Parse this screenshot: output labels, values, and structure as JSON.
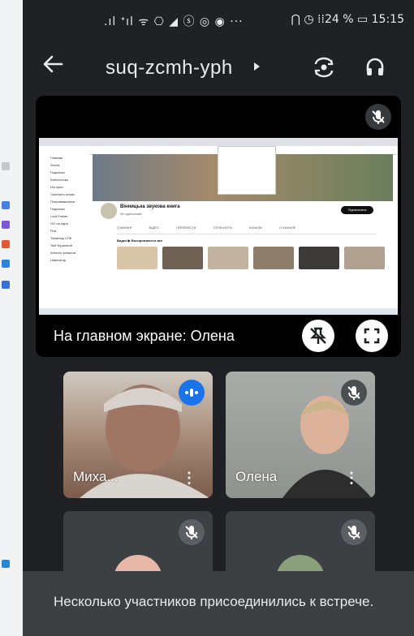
{
  "status_bar": {
    "left_icons": ".ıl ᐩıl ᯤ ⎔ ◢ ⓢ ◎ ◉ ···",
    "right_text": "⋂ ◷ ⁞⁞24 % ▭ 15:15"
  },
  "header": {
    "meeting_code": "suq-zcmh-yph"
  },
  "stage": {
    "label": "На главном экране: Олена",
    "shared_screen": {
      "channel_name": "Вінницька звукова книга",
      "channel_sub": "96 підписників",
      "subscribe_label": "Підписатися",
      "tabs": [
        "ГЛАВНАЯ",
        "ВІДЕО",
        "ПЛЕЙЛИСТИ",
        "СПІЛЬНОТА",
        "КАНАЛИ",
        "О КАНАЛЕ"
      ],
      "sidebar_items": [
        "Главная",
        "Shorts",
        "Подписки",
        "Библиотека",
        "История",
        "Смотреть позже",
        "Понравившиеся",
        "Подписки",
        "Lora Fabian",
        "ОО на парті",
        "Fink",
        "Таємниці СПБ",
        "Твій Музичний",
        "Каталог каналов",
        "Навигатор"
      ],
      "section_title": "Видео  ▶  Воспроизвести все"
    }
  },
  "tiles": [
    {
      "name": "Миха...",
      "bg": "#8b6a57"
    },
    {
      "name": "Олена",
      "bg": "#9a9e9a"
    },
    {
      "name": "",
      "bg": "#3c4043"
    },
    {
      "name": "",
      "bg": "#3c4043"
    }
  ],
  "toast": {
    "text": "Несколько участников присоединились к встрече."
  },
  "colors": {
    "background": "#202124",
    "tile_dark": "#3c4043",
    "speaking_blue": "#1a73e8"
  }
}
